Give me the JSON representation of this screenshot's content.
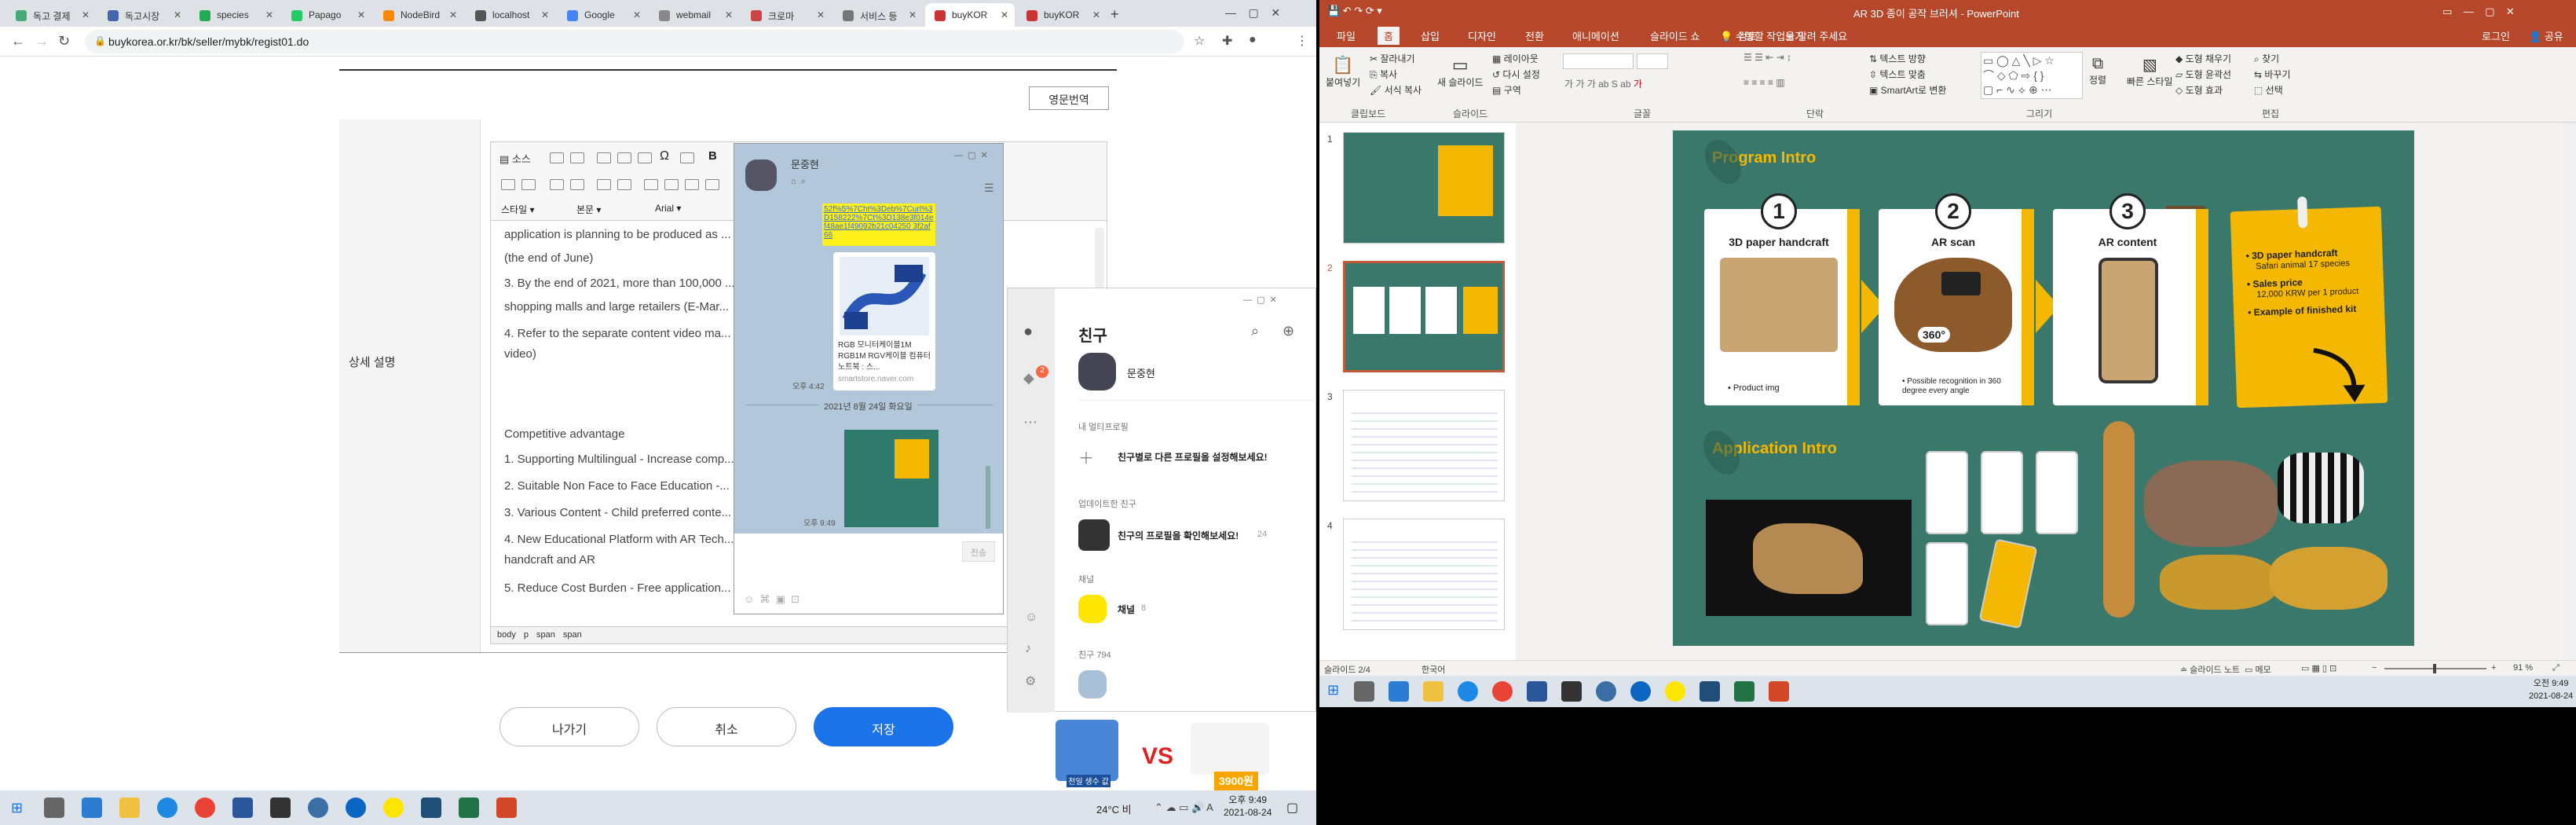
{
  "browser": {
    "tabs": [
      {
        "label": "독고 결제",
        "color": "#4a7"
      },
      {
        "label": "독고시장",
        "color": "#46a"
      },
      {
        "label": "species",
        "color": "#2a5"
      },
      {
        "label": "Papago",
        "color": "#2c6"
      },
      {
        "label": "NodeBird",
        "color": "#f80"
      },
      {
        "label": "localhost",
        "color": "#555"
      },
      {
        "label": "Google",
        "color": "#4285f4"
      },
      {
        "label": "webmail",
        "color": "#888"
      },
      {
        "label": "크로마",
        "color": "#c44"
      },
      {
        "label": "서비스 등",
        "color": "#777"
      },
      {
        "label": "buyKOR",
        "color": "#c33"
      },
      {
        "label": "buyKOR",
        "color": "#c33"
      }
    ],
    "url": "buykorea.or.kr/bk/seller/mybk/regist01.do"
  },
  "form": {
    "english_button": "영문번역",
    "field_label": "상세 설명",
    "toolbar": {
      "source": "소스",
      "style": "스타일",
      "format": "본문",
      "font": "Arial"
    },
    "lines": [
      "application is planning to be produced as ... students.",
      "(the end of June)",
      "3. By the end of 2021, more than 100,000 ... Internet",
      "shopping malls and large retailers (E-Mar...",
      "4. Refer to the separate content video ma...",
      "video)",
      "Competitive advantage",
      "1. Supporting Multilingual - Increase comp...",
      "2. Suitable Non Face to Face Education -...",
      "3. Various Content - Child preferred conte...",
      "4. New Educational Platform with AR Tech...",
      "handcraft and AR",
      "5. Reduce Cost Burden - Free application..."
    ],
    "status_path": [
      "body",
      "p",
      "span",
      "span"
    ],
    "buttons": {
      "exit": "나가기",
      "cancel": "취소",
      "save": "저장"
    }
  },
  "kakao_chat": {
    "name": "문중현",
    "link_text": "52f%5%7Cht%3Deb%7Curl%3D158222%7Ct%3D138e3f014ef48ae1f49092b21c04250 3f2af66",
    "product_title": "RGB 모니터케이블1M RGB1M RGV케이블 컴퓨터 노트북 : 스...",
    "product_source": "smartstore.naver.com",
    "time1": "오후 4:42",
    "date_divider": "2021년 8월 24일 화요일",
    "time2": "오후 9:49",
    "send_button": "전송"
  },
  "kakao_friends": {
    "title": "친구",
    "my_name": "문중현",
    "badge_count": "2",
    "multi_profile_label": "내 멀티프로필",
    "multi_profile_text": "친구별로 다른 프로필을 설정해보세요!",
    "updated_label": "업데이트한 친구",
    "updated_text": "친구의 프로필을 확인해보세요!",
    "updated_count": "24",
    "channel_label": "채널",
    "channel_name": "채널",
    "channel_count": "8",
    "friends_label": "친구",
    "friends_count": "794"
  },
  "ad": {
    "vs": "VS",
    "price": "3900원",
    "product_label": "천일 생수 값"
  },
  "taskbar_left": {
    "weather": "24°C 비",
    "time": "오후 9:49",
    "date": "2021-08-24"
  },
  "ppt": {
    "title": "AR 3D 종이 공작 브러셔 - PowerPoint",
    "user": "로그인",
    "share": "공유",
    "menu": [
      "파일",
      "홈",
      "삽입",
      "디자인",
      "전환",
      "애니메이션",
      "슬라이드 쇼",
      "검토",
      "보기"
    ],
    "active_menu": "홈",
    "search_hint": "수행할 작업을 알려 주세요",
    "groups": [
      "클립보드",
      "슬라이드",
      "글꼴",
      "단락",
      "그리기",
      "편집"
    ],
    "clipboard": {
      "paste": "붙여넣기",
      "cut": "잘라내기",
      "copy": "복사",
      "format_painter": "서식 복사"
    },
    "slides_group": {
      "new_slide": "새 슬라이드",
      "layout": "레이아웃",
      "reset": "다시 설정",
      "section": "구역"
    },
    "paragraph": {
      "text_direction": "텍스트 방향",
      "align_text": "텍스트 맞춤",
      "smartart": "SmartArt로 변환"
    },
    "drawing": {
      "arrange": "정렬",
      "quick_styles": "빠른 스타일",
      "fill": "도형 채우기",
      "outline": "도형 윤곽선",
      "effects": "도형 효과"
    },
    "editing": {
      "find": "찾기",
      "replace": "바꾸기",
      "select": "선택"
    },
    "slide_numbers": [
      "1",
      "2",
      "3",
      "4"
    ],
    "status": {
      "slide": "슬라이드 2/4",
      "lang": "한국어",
      "notes": "슬라이드 노트",
      "memo": "메모",
      "zoom": "91 %"
    },
    "slide": {
      "program_intro": "Program Intro",
      "cards": [
        {
          "num": "1",
          "title": "3D paper handcraft",
          "caption": "Product img"
        },
        {
          "num": "2",
          "title": "AR scan",
          "caption": "Possible recognition in 360 degree every angle",
          "badge": "360°"
        },
        {
          "num": "3",
          "title": "AR content",
          "caption": ""
        }
      ],
      "note": [
        {
          "head": "3D paper handcraft",
          "sub": "Safari animal 17 species"
        },
        {
          "head": "Sales price",
          "sub": "12,000 KRW per 1 product"
        },
        {
          "head": "Example of finished kit",
          "sub": ""
        }
      ],
      "app_intro": "Application Intro"
    }
  },
  "taskbar_right": {
    "time": "오전 9:49",
    "date": "2021-08-24"
  }
}
